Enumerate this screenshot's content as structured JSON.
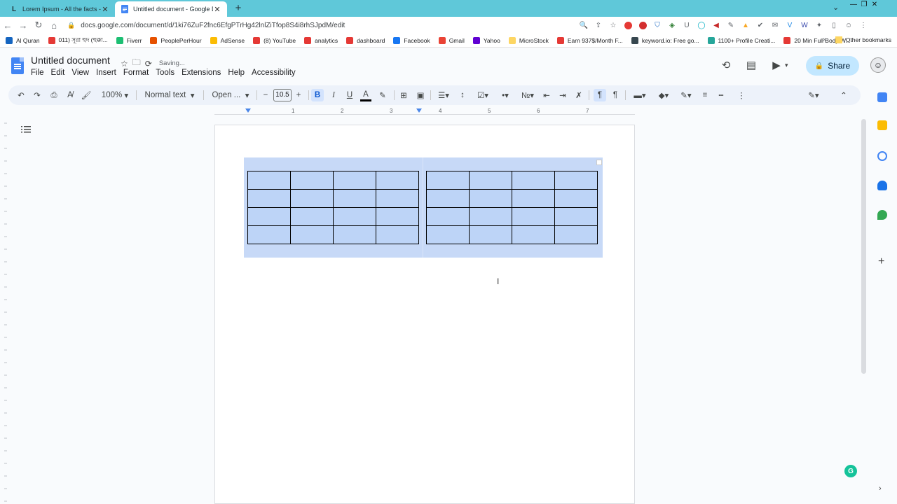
{
  "browser": {
    "tabs": [
      {
        "title": "Lorem Ipsum - All the facts - Lip",
        "icon": "L"
      },
      {
        "title": "Untitled document - Google Doc",
        "icon": "docs-icon"
      }
    ],
    "new_tab": "+",
    "url": "docs.google.com/document/d/1ki76ZuF2fnc6EfgPTrHg42lnlZiTfop8S4i8rhSJpdM/edit",
    "bookmarks": [
      {
        "label": "Al Quran",
        "color": "#1565c0"
      },
      {
        "label": "011) সূরা হুদ (হুক্কা...",
        "color": "#e53935"
      },
      {
        "label": "Fiverr",
        "color": "#1dbf73"
      },
      {
        "label": "PeoplePerHour",
        "color": "#e65100"
      },
      {
        "label": "AdSense",
        "color": "#fbbc04"
      },
      {
        "label": "(8) YouTube",
        "color": "#e53935"
      },
      {
        "label": "analytics",
        "color": "#e53935"
      },
      {
        "label": "dashboard",
        "color": "#e53935"
      },
      {
        "label": "Facebook",
        "color": "#1877f2"
      },
      {
        "label": "Gmail",
        "color": "#ea4335"
      },
      {
        "label": "Yahoo",
        "color": "#6001d2"
      },
      {
        "label": "MicroStock",
        "color": "#fdd663"
      },
      {
        "label": "Earn 937$/Month F...",
        "color": "#e53935"
      },
      {
        "label": "keyword.io: Free go...",
        "color": "#37474f"
      },
      {
        "label": "1100+ Profile Creati...",
        "color": "#26a69a"
      },
      {
        "label": "20 Min Full Body W...",
        "color": "#e53935"
      }
    ],
    "bookmarks_more": "»",
    "other_bookmarks": "Other bookmarks"
  },
  "docs": {
    "title": "Untitled document",
    "status": "Saving...",
    "menu": [
      "File",
      "Edit",
      "View",
      "Insert",
      "Format",
      "Tools",
      "Extensions",
      "Help",
      "Accessibility"
    ],
    "share_label": "Share",
    "toolbar": {
      "zoom": "100%",
      "style": "Normal text",
      "font": "Open ...",
      "font_size": "10.5",
      "bold": "B",
      "italic": "I",
      "underline": "U",
      "text_color": "A",
      "minus": "−",
      "plus": "+"
    },
    "ruler": [
      "1",
      "2",
      "3",
      "4",
      "5",
      "6",
      "7"
    ]
  },
  "colors": {
    "tabstrip": "#5fc8d9",
    "selection": "#c7d9f7",
    "share_bg": "#c2e7ff",
    "docs_blue": "#4285f4"
  }
}
